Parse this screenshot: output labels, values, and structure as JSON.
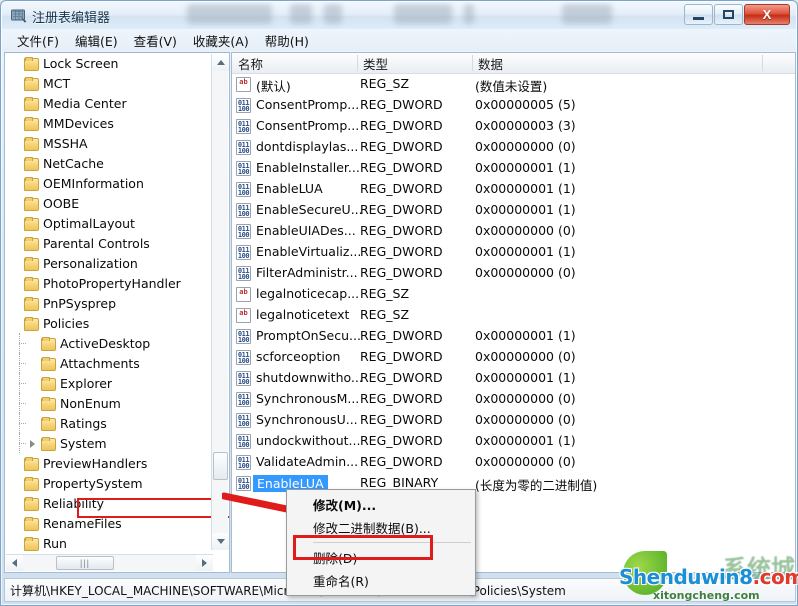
{
  "window": {
    "title": "注册表编辑器",
    "icon": "registry-editor-icon",
    "buttons": {
      "minimize": "–",
      "maximize": "□",
      "close": "X"
    }
  },
  "menubar": {
    "items": [
      {
        "label": "文件(F)",
        "name": "menu-file"
      },
      {
        "label": "编辑(E)",
        "name": "menu-edit"
      },
      {
        "label": "查看(V)",
        "name": "menu-view"
      },
      {
        "label": "收藏夹(A)",
        "name": "menu-favorites"
      },
      {
        "label": "帮助(H)",
        "name": "menu-help"
      }
    ]
  },
  "tree": {
    "nodes": [
      {
        "label": "Lock Screen",
        "depth": 0,
        "expander": false,
        "selected": false
      },
      {
        "label": "MCT",
        "depth": 0,
        "expander": false,
        "selected": false
      },
      {
        "label": "Media Center",
        "depth": 0,
        "expander": false,
        "selected": false
      },
      {
        "label": "MMDevices",
        "depth": 0,
        "expander": false,
        "selected": false
      },
      {
        "label": "MSSHA",
        "depth": 0,
        "expander": false,
        "selected": false
      },
      {
        "label": "NetCache",
        "depth": 0,
        "expander": false,
        "selected": false
      },
      {
        "label": "OEMInformation",
        "depth": 0,
        "expander": false,
        "selected": false
      },
      {
        "label": "OOBE",
        "depth": 0,
        "expander": false,
        "selected": false
      },
      {
        "label": "OptimalLayout",
        "depth": 0,
        "expander": false,
        "selected": false
      },
      {
        "label": "Parental Controls",
        "depth": 0,
        "expander": false,
        "selected": false
      },
      {
        "label": "Personalization",
        "depth": 0,
        "expander": false,
        "selected": false
      },
      {
        "label": "PhotoPropertyHandler",
        "depth": 0,
        "expander": false,
        "selected": false
      },
      {
        "label": "PnPSysprep",
        "depth": 0,
        "expander": false,
        "selected": false
      },
      {
        "label": "Policies",
        "depth": 0,
        "expander": false,
        "selected": false
      },
      {
        "label": "ActiveDesktop",
        "depth": 1,
        "expander": false,
        "selected": false
      },
      {
        "label": "Attachments",
        "depth": 1,
        "expander": false,
        "selected": false
      },
      {
        "label": "Explorer",
        "depth": 1,
        "expander": false,
        "selected": false
      },
      {
        "label": "NonEnum",
        "depth": 1,
        "expander": false,
        "selected": false
      },
      {
        "label": "Ratings",
        "depth": 1,
        "expander": false,
        "selected": false
      },
      {
        "label": "System",
        "depth": 1,
        "expander": true,
        "selected": true
      },
      {
        "label": "PreviewHandlers",
        "depth": 0,
        "expander": false,
        "selected": false
      },
      {
        "label": "PropertySystem",
        "depth": 0,
        "expander": false,
        "selected": false
      },
      {
        "label": "Reliability",
        "depth": 0,
        "expander": false,
        "selected": false
      },
      {
        "label": "RenameFiles",
        "depth": 0,
        "expander": false,
        "selected": false
      },
      {
        "label": "Run",
        "depth": 0,
        "expander": false,
        "selected": false
      }
    ],
    "scroll_thumb_label": "|||"
  },
  "list": {
    "columns": [
      {
        "label": "名称",
        "name": "column-name"
      },
      {
        "label": "类型",
        "name": "column-type"
      },
      {
        "label": "数据",
        "name": "column-data"
      }
    ],
    "rows": [
      {
        "name": "(默认)",
        "icon": "ab",
        "type": "REG_SZ",
        "data": "(数值未设置)",
        "selected": false
      },
      {
        "name": "ConsentPromp...",
        "icon": "bin",
        "type": "REG_DWORD",
        "data": "0x00000005 (5)",
        "selected": false
      },
      {
        "name": "ConsentPromp...",
        "icon": "bin",
        "type": "REG_DWORD",
        "data": "0x00000003 (3)",
        "selected": false
      },
      {
        "name": "dontdisplaylas...",
        "icon": "bin",
        "type": "REG_DWORD",
        "data": "0x00000000 (0)",
        "selected": false
      },
      {
        "name": "EnableInstaller...",
        "icon": "bin",
        "type": "REG_DWORD",
        "data": "0x00000001 (1)",
        "selected": false
      },
      {
        "name": "EnableLUA",
        "icon": "bin",
        "type": "REG_DWORD",
        "data": "0x00000001 (1)",
        "selected": false
      },
      {
        "name": "EnableSecureU...",
        "icon": "bin",
        "type": "REG_DWORD",
        "data": "0x00000001 (1)",
        "selected": false
      },
      {
        "name": "EnableUIADes...",
        "icon": "bin",
        "type": "REG_DWORD",
        "data": "0x00000000 (0)",
        "selected": false
      },
      {
        "name": "EnableVirtualiz...",
        "icon": "bin",
        "type": "REG_DWORD",
        "data": "0x00000001 (1)",
        "selected": false
      },
      {
        "name": "FilterAdministr...",
        "icon": "bin",
        "type": "REG_DWORD",
        "data": "0x00000000 (0)",
        "selected": false
      },
      {
        "name": "legalnoticecap...",
        "icon": "ab",
        "type": "REG_SZ",
        "data": "",
        "selected": false
      },
      {
        "name": "legalnoticetext",
        "icon": "ab",
        "type": "REG_SZ",
        "data": "",
        "selected": false
      },
      {
        "name": "PromptOnSecu...",
        "icon": "bin",
        "type": "REG_DWORD",
        "data": "0x00000001 (1)",
        "selected": false
      },
      {
        "name": "scforceoption",
        "icon": "bin",
        "type": "REG_DWORD",
        "data": "0x00000000 (0)",
        "selected": false
      },
      {
        "name": "shutdownwitho...",
        "icon": "bin",
        "type": "REG_DWORD",
        "data": "0x00000001 (1)",
        "selected": false
      },
      {
        "name": "SynchronousM...",
        "icon": "bin",
        "type": "REG_DWORD",
        "data": "0x00000000 (0)",
        "selected": false
      },
      {
        "name": "SynchronousU...",
        "icon": "bin",
        "type": "REG_DWORD",
        "data": "0x00000000 (0)",
        "selected": false
      },
      {
        "name": "undockwithout...",
        "icon": "bin",
        "type": "REG_DWORD",
        "data": "0x00000001 (1)",
        "selected": false
      },
      {
        "name": "ValidateAdmin...",
        "icon": "bin",
        "type": "REG_DWORD",
        "data": "0x00000000 (0)",
        "selected": false
      },
      {
        "name": "EnableLUA",
        "icon": "bin",
        "type": "REG_BINARY",
        "data": "(长度为零的二进制值)",
        "selected": true
      }
    ]
  },
  "context_menu": {
    "items": [
      {
        "label": "修改(M)...",
        "name": "context-modify",
        "bold": true,
        "separator_after": false,
        "highlighted": false
      },
      {
        "label": "修改二进制数据(B)...",
        "name": "context-modify-binary",
        "bold": false,
        "separator_after": true,
        "highlighted": false
      },
      {
        "label": "删除(D)",
        "name": "context-delete",
        "bold": false,
        "separator_after": false,
        "highlighted": true
      },
      {
        "label": "重命名(R)",
        "name": "context-rename",
        "bold": false,
        "separator_after": false,
        "highlighted": false
      }
    ]
  },
  "statusbar": {
    "path": "计算机\\HKEY_LOCAL_MACHINE\\SOFTWARE\\Microsoft\\Windows\\CurrentVersion\\Policies\\System"
  },
  "watermark": {
    "main": "Shenduwin8",
    "main_suffix": ".com",
    "sub": "xitongcheng.com",
    "ghost": "系统城"
  },
  "colors": {
    "accent_selection": "#3399ff",
    "annotation_red": "#e01b1b",
    "titlebar_text": "#17334d",
    "close_button": "#c42d16"
  }
}
